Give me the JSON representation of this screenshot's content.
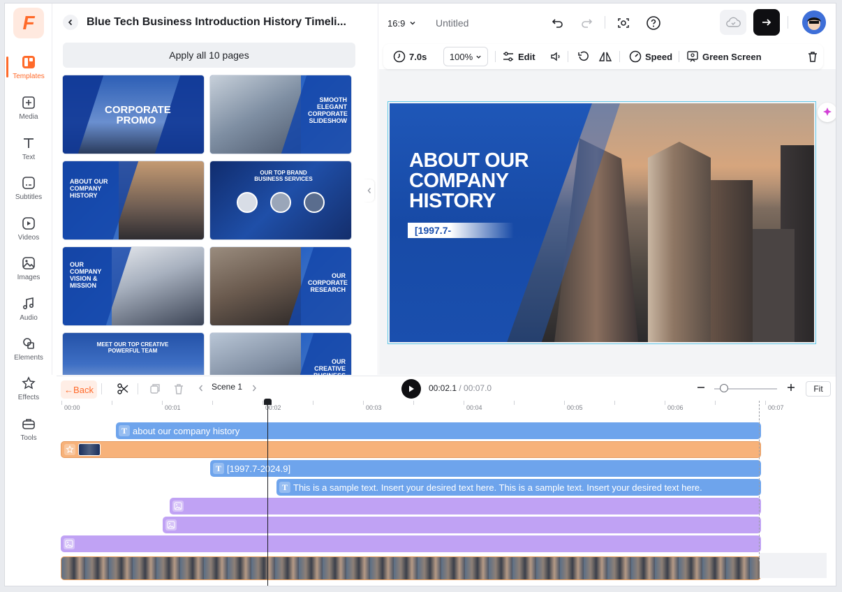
{
  "app": {
    "logo_letter": "F",
    "accent": "#ff6a2a"
  },
  "rail": {
    "items": [
      {
        "label": "Templates",
        "icon": "templates-icon",
        "active": true
      },
      {
        "label": "Media",
        "icon": "media-icon"
      },
      {
        "label": "Text",
        "icon": "text-icon"
      },
      {
        "label": "Subtitles",
        "icon": "subtitles-icon"
      },
      {
        "label": "Videos",
        "icon": "videos-icon"
      },
      {
        "label": "Images",
        "icon": "images-icon"
      },
      {
        "label": "Audio",
        "icon": "audio-icon"
      },
      {
        "label": "Elements",
        "icon": "elements-icon"
      },
      {
        "label": "Effects",
        "icon": "effects-icon"
      },
      {
        "label": "Tools",
        "icon": "tools-icon"
      }
    ]
  },
  "panel": {
    "title": "Blue Tech Business Introduction History Timeli...",
    "apply_label": "Apply all 10 pages",
    "thumbnails": [
      {
        "text": "CORPORATE PROMO"
      },
      {
        "text": "SMOOTH ELEGANT CORPORATE SLIDESHOW"
      },
      {
        "text": "ABOUT OUR COMPANY HISTORY"
      },
      {
        "text": "OUR TOP BRAND BUSINESS SERVICES"
      },
      {
        "text": "OUR COMPANY VISION & MISSION"
      },
      {
        "text": "OUR CORPORATE RESEARCH"
      },
      {
        "text": "MEET OUR TOP CREATIVE POWERFUL TEAM"
      },
      {
        "text": "OUR CREATIVE BUSINESS MARKET SIZE"
      }
    ]
  },
  "topbar": {
    "aspect": "16:9",
    "doc_title": "Untitled"
  },
  "editbar": {
    "duration": "7.0s",
    "zoom": "100%",
    "edit_label": "Edit",
    "speed_label": "Speed",
    "green_screen_label": "Green Screen"
  },
  "canvas": {
    "title": "ABOUT OUR COMPANY HISTORY",
    "subtitle": "[1997.7-"
  },
  "timeline": {
    "back_label": "Back",
    "scene_label": "Scene 1",
    "current_time": "00:02.1",
    "total_time": "/ 00:07.0",
    "fit_label": "Fit",
    "ruler": [
      "00:00",
      "00:01",
      "00:02",
      "00:03",
      "00:04",
      "00:05",
      "00:06",
      "00:07"
    ],
    "tracks": {
      "text1": "about our  company  history",
      "text2": "[1997.7-2024.9]",
      "text3": "This is a sample text. Insert  your desired text here. This is  a sample text. Insert your  desired text here."
    }
  }
}
